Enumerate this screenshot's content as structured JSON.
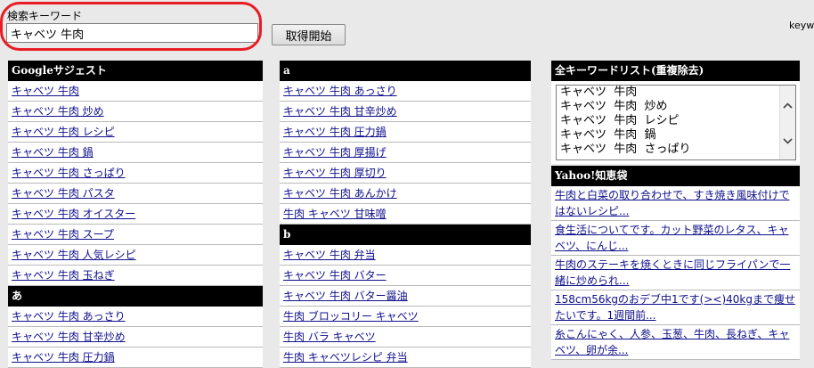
{
  "search": {
    "label": "検索キーワード",
    "value": "キャベツ 牛肉",
    "button_label": "取得開始",
    "side_text": "keyw"
  },
  "google": {
    "header": "Googleサジェスト",
    "items": [
      "キャベツ 牛肉",
      "キャベツ 牛肉 炒め",
      "キャベツ 牛肉 レシピ",
      "キャベツ 牛肉 鍋",
      "キャベツ 牛肉 さっぱり",
      "キャベツ 牛肉 パスタ",
      "キャベツ 牛肉 オイスター",
      "キャベツ 牛肉 スープ",
      "キャベツ 牛肉 人気レシピ",
      "キャベツ 牛肉 玉ねぎ"
    ]
  },
  "section_a_jp": {
    "header": "あ",
    "items": [
      "キャベツ 牛肉 あっさり",
      "キャベツ 牛肉 甘辛炒め",
      "キャベツ 牛肉 圧力鍋"
    ]
  },
  "section_a": {
    "header": "a",
    "items": [
      "キャベツ 牛肉 あっさり",
      "キャベツ 牛肉 甘辛炒め",
      "キャベツ 牛肉 圧力鍋",
      "キャベツ 牛肉 厚揚げ",
      "キャベツ 牛肉 厚切り",
      "キャベツ 牛肉 あんかけ",
      "牛肉 キャベツ 甘味噌"
    ]
  },
  "section_b": {
    "header": "b",
    "items": [
      "キャベツ 牛肉 弁当",
      "キャベツ 牛肉 バター",
      "キャベツ 牛肉 バター醤油",
      "牛肉 ブロッコリー キャベツ",
      "牛肉 バラ キャベツ",
      "牛肉 キャベツレシピ 弁当"
    ]
  },
  "all_keywords": {
    "header": "全キーワードリスト(重複除去)",
    "items": [
      "キャベツ  牛肉",
      "キャベツ  牛肉  炒め",
      "キャベツ  牛肉  レシピ",
      "キャベツ  牛肉  鍋",
      "キャベツ  牛肉  さっぱり"
    ]
  },
  "yahoo": {
    "header": "Yahoo!知恵袋",
    "items": [
      "牛肉と白菜の取り合わせで、すき焼き風味付けではないレシピ...",
      "食生活についてです。カット野菜のレタス、キャベツ、にんじ...",
      "牛肉のステーキを焼くときに同じフライパンで一緒に炒められ...",
      "158cm56kgのおデブ中1です(><)40kgまで痩せたいです。1週間前...",
      "糸こんにゃく、人参、玉葱、牛肉、長ねぎ、キャベツ、卵が余..."
    ]
  },
  "icons": {
    "scroll_up": "chevron-up-icon",
    "scroll_down": "chevron-down-icon"
  },
  "colors": {
    "highlight": "#e81c24",
    "link": "#0f0f8c",
    "header_bg": "#000000",
    "page_bg": "#e9e9e9"
  }
}
